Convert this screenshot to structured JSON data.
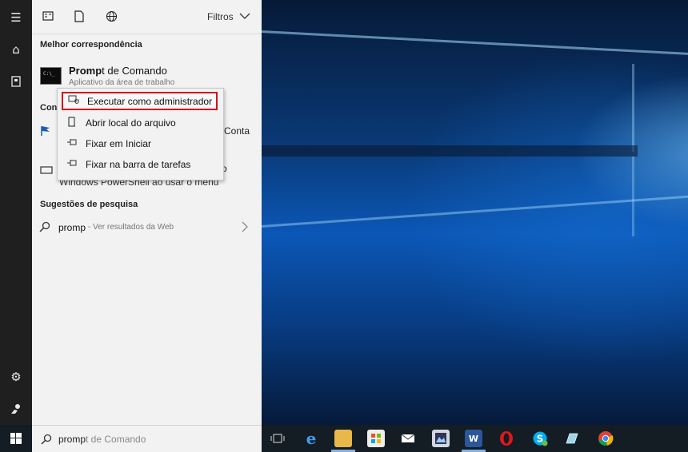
{
  "panel": {
    "filters_label": "Filtros",
    "best_match_title": "Melhor correspondência",
    "best_match": {
      "title_bold": "Promp",
      "title_rest": "t de Comando",
      "subtitle": "Aplicativo da área de trabalho"
    },
    "settings_title_partial": "Conf",
    "row1_right_partial": "Conta",
    "row2_right_partial": "o",
    "row2_line2": "Windows PowerShell ao usar o menu",
    "suggestions_title": "Sugestões de pesquisa",
    "suggestion": {
      "query": "promp",
      "suffix": " - Ver resultados da Web"
    }
  },
  "context_menu": {
    "items": [
      {
        "label": "Executar como administrador",
        "icon": "run-as-admin-icon",
        "highlighted": true
      },
      {
        "label": "Abrir local do arquivo",
        "icon": "file-location-icon"
      },
      {
        "label": "Fixar em Iniciar",
        "icon": "pin-icon"
      },
      {
        "label": "Fixar na barra de tarefas",
        "icon": "pin-icon"
      }
    ]
  },
  "search": {
    "typed": "promp",
    "completion": "t de Comando"
  },
  "colors": {
    "highlight_border": "#d0121b",
    "taskbar": "#141c24",
    "panel": "#f2f2f2",
    "rail": "#1f1f1f"
  }
}
